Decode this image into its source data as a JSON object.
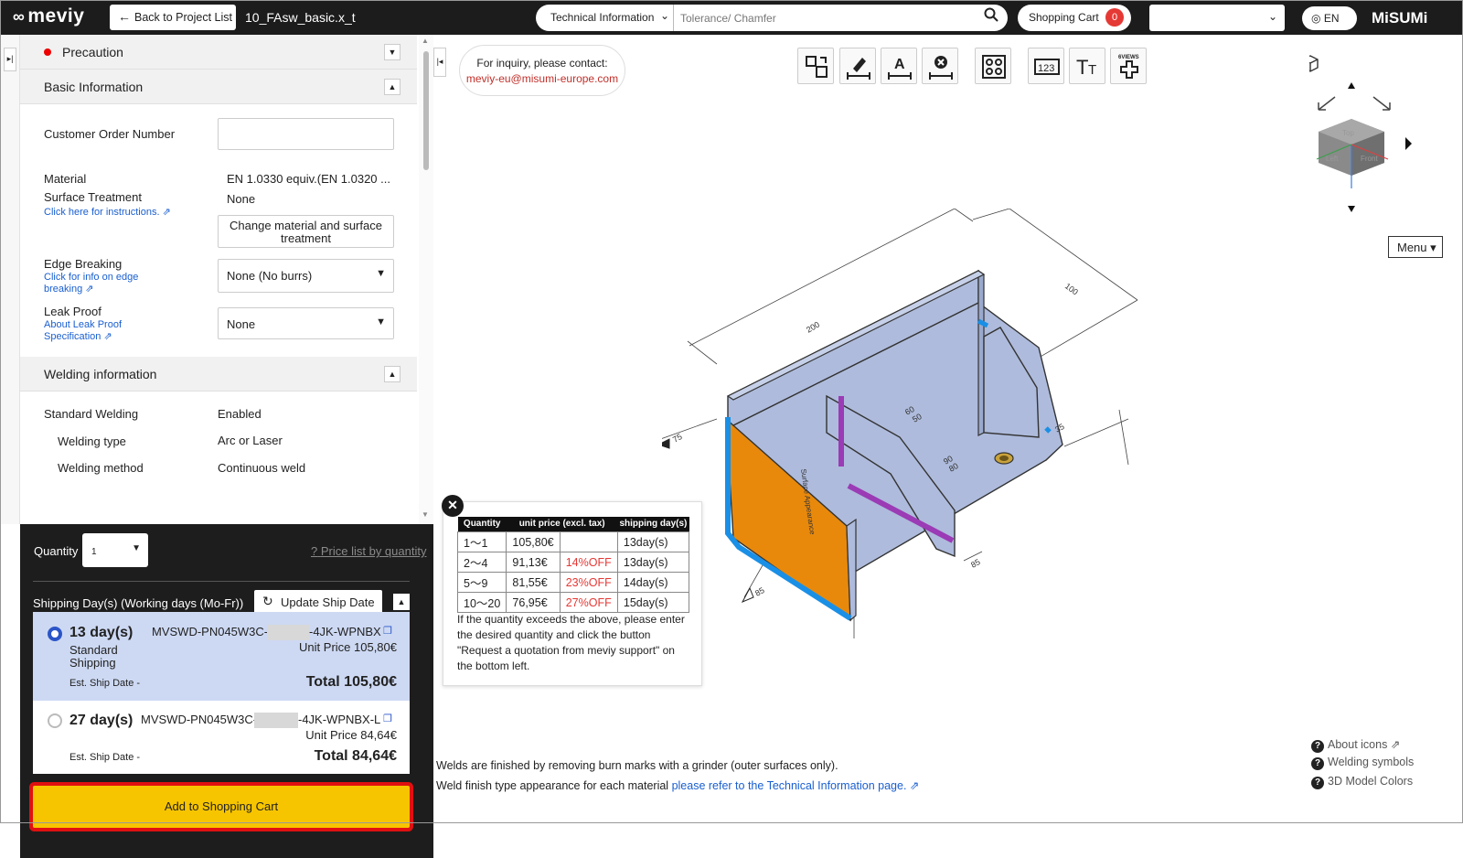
{
  "topbar": {
    "logo": "meviy",
    "back_label": "Back to Project List",
    "project_name": "10_FAsw_basic.x_t",
    "search_category": "Technical Information",
    "search_placeholder": "Tolerance/ Chamfer",
    "cart_label": "Shopping Cart",
    "cart_count": "0",
    "lang": "EN",
    "brand": "MiSUMi"
  },
  "sidebar": {
    "precaution": "Precaution",
    "basic_info": "Basic Information",
    "customer_order_label": "Customer Order Number",
    "material_label": "Material",
    "material_value": "EN 1.0330 equiv.(EN 1.0320 ...",
    "surface_label": "Surface Treatment",
    "surface_value": "None",
    "surface_link": "Click here for instructions.",
    "change_button": "Change material and surface treatment",
    "edge_label": "Edge Breaking",
    "edge_link": "Click for info on edge breaking",
    "edge_value": "None (No burrs)",
    "leak_label": "Leak Proof",
    "leak_link": "About Leak Proof Specification",
    "leak_value": "None",
    "welding_info": "Welding information",
    "std_welding_label": "Standard Welding",
    "std_welding_value": "Enabled",
    "welding_type_label": "Welding type",
    "welding_type_value": "Arc or Laser",
    "welding_method_label": "Welding method",
    "welding_method_value": "Continuous weld"
  },
  "order": {
    "quantity_label": "Quantity",
    "quantity_value": "1",
    "price_list_link": "Price list by quantity",
    "shipping_label": "Shipping Day(s) (Working days (Mo-Fr))",
    "update_button": "Update Ship Date",
    "options": [
      {
        "days": "13 day(s)",
        "method": "Standard Shipping",
        "code_a": "MVSWD-PN045W3C-",
        "code_b": "-4JK-WPNBX",
        "unit_price": "Unit Price 105,80€",
        "est": "Est. Ship Date -",
        "total": "Total 105,80€",
        "selected": true
      },
      {
        "days": "27 day(s)",
        "method": "",
        "code_a": "MVSWD-PN045W3C-",
        "code_b": "-4JK-WPNBX-L",
        "unit_price": "Unit Price 84,64€",
        "est": "Est. Ship Date -",
        "total": "Total 84,64€",
        "selected": false
      }
    ],
    "add_to_cart": "Add to Shopping Cart"
  },
  "viewer": {
    "inquiry_line1": "For inquiry, please contact:",
    "inquiry_email": "meviy-eu@misumi-europe.com",
    "menu_label": "Menu",
    "toolbar_icons": [
      "flip-icon",
      "edit-dimension-icon",
      "text-dimension-icon",
      "clear-dimension-icon",
      "hole-view-icon",
      "dimension-numbers-icon",
      "font-size-icon",
      "six-views-icon"
    ],
    "sixviews_label": "6VIEWS",
    "nav_labels": {
      "top": "Top",
      "left": "Left",
      "front": "Front"
    },
    "dimensions": [
      "200",
      "100",
      "75",
      "85",
      "35",
      "60",
      "50",
      "90",
      "80",
      "85"
    ],
    "weld_label": "Surface Appearance",
    "note_line1": "Welds are finished by removing burn marks with a grinder (outer surfaces only).",
    "note_line2_prefix": "Weld finish type appearance for each material ",
    "note_line2_link": "please refer to the Technical Information page.",
    "help_links": [
      "About icons",
      "Welding symbols",
      "3D Model Colors"
    ]
  },
  "price_popup": {
    "headers": [
      "Quantity",
      "unit price (excl. tax)",
      "",
      "shipping day(s)"
    ],
    "rows": [
      {
        "qty": "1～1",
        "price": "105,80€",
        "off": "",
        "days": "13day(s)"
      },
      {
        "qty": "2～4",
        "price": "91,13€",
        "off": "14%OFF",
        "days": "13day(s)"
      },
      {
        "qty": "5～9",
        "price": "81,55€",
        "off": "23%OFF",
        "days": "14day(s)"
      },
      {
        "qty": "10～20",
        "price": "76,95€",
        "off": "27%OFF",
        "days": "15day(s)"
      }
    ],
    "note": "If the quantity exceeds the above, please enter the desired quantity and click the button \"Request a quotation from meviy support\" on the bottom left."
  },
  "colors": {
    "accent": "#f7c500",
    "highlight": "#e01010",
    "selected_bg": "#cdd9f3",
    "part": "#aebbdc",
    "weld_face": "#e8890c",
    "edge_blue": "#1a8fe6",
    "weld_purple": "#9b3bb5"
  }
}
